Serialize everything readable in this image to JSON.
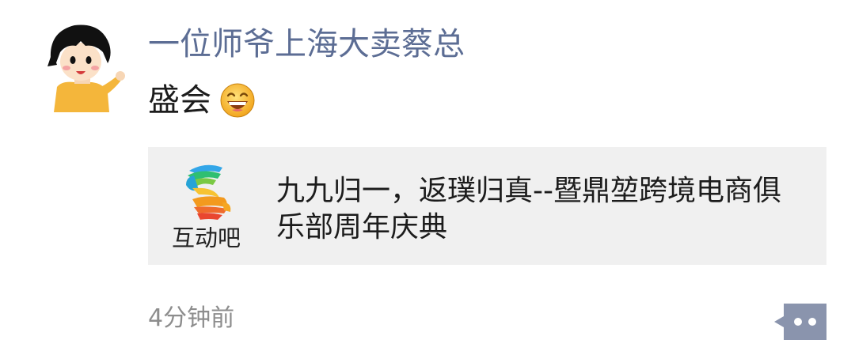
{
  "post": {
    "author_name": "一位师爷上海大卖蔡总",
    "text": "盛会",
    "emoji": "grinning-face-emoji"
  },
  "link_card": {
    "source_name": "互动吧",
    "title": "九九归一，返璞归真--暨鼎堃跨境电商俱乐部周年庆典"
  },
  "meta": {
    "timestamp": "4分钟前"
  },
  "icons": {
    "avatar": "cartoon-girl-avatar",
    "logo": "hudongba-hand-logo-icon",
    "more": "more-actions-icon"
  },
  "colors": {
    "author_name": "#5c6d94",
    "card_background": "#f0f0f0",
    "timestamp": "#8d8d8d",
    "more_button": "#8a94ad"
  }
}
